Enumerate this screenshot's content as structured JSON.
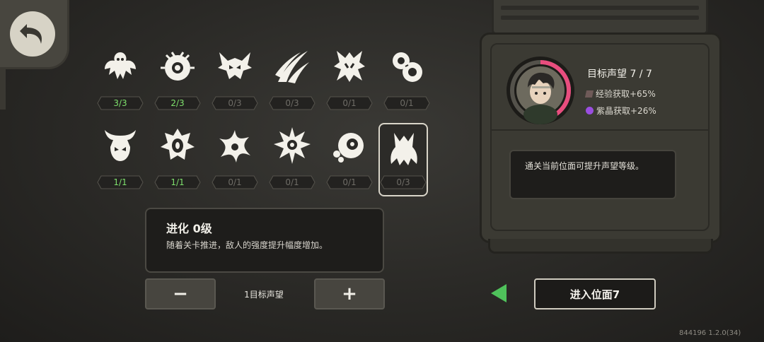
{
  "back_button": {
    "icon": "undo-arrow-icon"
  },
  "evolutions": [
    {
      "icon": "winged-spirit-icon",
      "progress": "3/3",
      "complete": true
    },
    {
      "icon": "cyclops-orb-icon",
      "progress": "2/3",
      "complete": true
    },
    {
      "icon": "demon-horns-icon",
      "progress": "0/3",
      "complete": false
    },
    {
      "icon": "claw-swipe-icon",
      "progress": "0/3",
      "complete": false
    },
    {
      "icon": "tentacle-mask-icon",
      "progress": "0/1",
      "complete": false
    },
    {
      "icon": "swirl-beast-icon",
      "progress": "0/1",
      "complete": false
    },
    {
      "icon": "horned-skull-icon",
      "progress": "1/1",
      "complete": true
    },
    {
      "icon": "crowned-eye-icon",
      "progress": "1/1",
      "complete": true
    },
    {
      "icon": "starfish-icon",
      "progress": "0/1",
      "complete": false
    },
    {
      "icon": "spiked-eye-icon",
      "progress": "0/1",
      "complete": false
    },
    {
      "icon": "eyeball-cluster-icon",
      "progress": "0/1",
      "complete": false
    },
    {
      "icon": "root-claw-icon",
      "progress": "0/3",
      "complete": false
    }
  ],
  "evolution_info": {
    "title": "进化 0级",
    "description": "随着关卡推进，敌人的强度提升幅度增加。"
  },
  "stepper": {
    "minus": "−",
    "plus": "+",
    "label": "1目标声望"
  },
  "reputation": {
    "title": "目标声望 7 / 7",
    "exp_bonus": "经验获取+65%",
    "crystal_bonus": "紫晶获取+26%",
    "progress_fraction": 0.45
  },
  "hint": "通关当前位面可提升声望等级。",
  "enter_button": "进入位面7",
  "version": "844196 1.2.0(34)",
  "colors": {
    "complete": "#7ee06c",
    "incomplete": "#6e6c66",
    "accent": "#e84d7e",
    "arrow": "#4fc25b"
  }
}
